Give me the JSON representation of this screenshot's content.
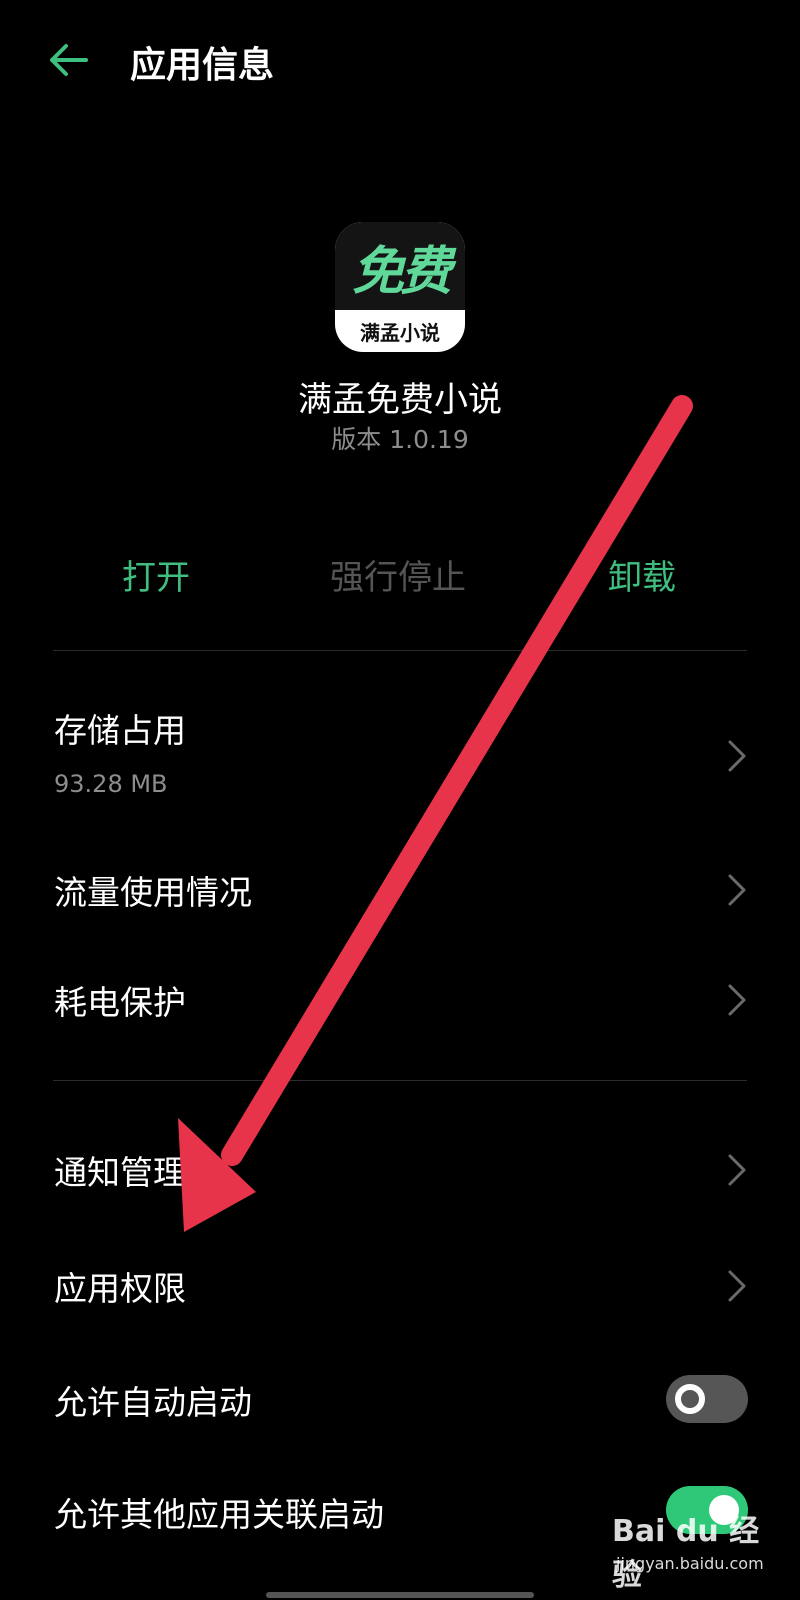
{
  "header": {
    "title": "应用信息"
  },
  "app": {
    "icon_top_text": "免费",
    "icon_bottom_text": "满孟小说",
    "name": "满孟免费小说",
    "version": "版本 1.0.19"
  },
  "actions": {
    "open": "打开",
    "force_stop": "强行停止",
    "uninstall": "卸载"
  },
  "settings": {
    "storage": {
      "label": "存储占用",
      "value": "93.28 MB"
    },
    "data_usage": {
      "label": "流量使用情况"
    },
    "battery": {
      "label": "耗电保护"
    },
    "notifications": {
      "label": "通知管理"
    },
    "permissions": {
      "label": "应用权限"
    },
    "auto_start": {
      "label": "允许自动启动",
      "enabled": false
    },
    "associated_start": {
      "label": "允许其他应用关联启动",
      "enabled": true
    }
  },
  "watermark": {
    "brand": "Bai du 经验",
    "url": "jingyan.baidu.com"
  },
  "colors": {
    "accent": "#3fbf7f",
    "background": "#000000",
    "arrow": "#e8344a",
    "toggle_on": "#2ec878",
    "toggle_off": "#565656"
  }
}
